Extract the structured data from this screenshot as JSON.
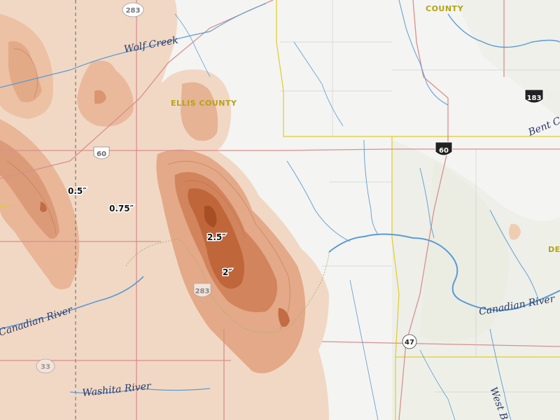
{
  "map": {
    "rivers": [
      {
        "name": "Wolf Creek"
      },
      {
        "name": "Canadian River"
      },
      {
        "name": "Canadian River"
      },
      {
        "name": "Washita River"
      },
      {
        "name": "Bent Cr"
      },
      {
        "name": "West Ba"
      }
    ],
    "counties": [
      {
        "name": "COUNTY"
      },
      {
        "name": "ELLIS COUNTY"
      },
      {
        "name": "DE"
      }
    ],
    "highways": [
      {
        "number": "283",
        "type": "state"
      },
      {
        "number": "60",
        "type": "us"
      },
      {
        "number": "60",
        "type": "us"
      },
      {
        "number": "183",
        "type": "us"
      },
      {
        "number": "283",
        "type": "us"
      },
      {
        "number": "47",
        "type": "state"
      },
      {
        "number": "33",
        "type": "state"
      }
    ],
    "rainfall_labels": [
      {
        "text": "0.5″"
      },
      {
        "text": "0.75″"
      },
      {
        "text": "2.5″"
      },
      {
        "text": "2″"
      }
    ],
    "colors": {
      "background": "#f4f4f2",
      "water": "#5b9bd5",
      "road": "#d88f8f",
      "county_line": "#e0cc2a",
      "state_line": "#777777",
      "rain_light": "#efc0a0",
      "rain_dark": "#b85a2a"
    }
  }
}
